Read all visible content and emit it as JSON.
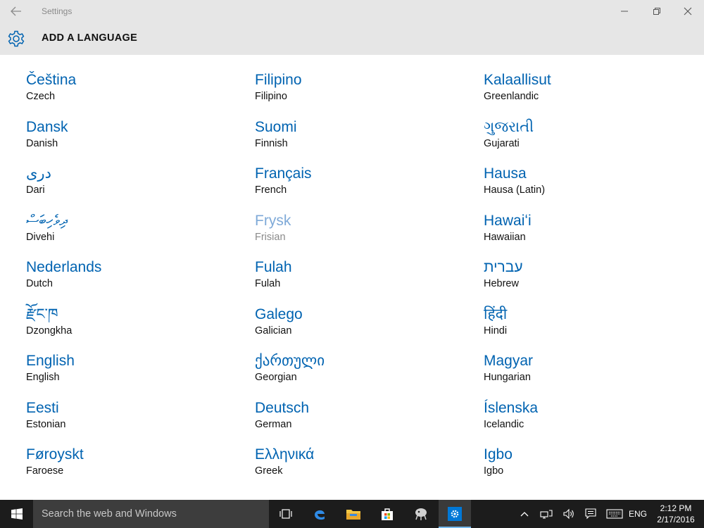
{
  "window": {
    "title": "Settings",
    "page_title": "ADD A LANGUAGE"
  },
  "columns": [
    [
      {
        "native": "Čeština",
        "english": "Czech",
        "enabled": true
      },
      {
        "native": "Dansk",
        "english": "Danish",
        "enabled": true
      },
      {
        "native": "درى",
        "english": "Dari",
        "enabled": true
      },
      {
        "native": "ދިވެހިބަސް",
        "english": "Divehi",
        "enabled": true
      },
      {
        "native": "Nederlands",
        "english": "Dutch",
        "enabled": true
      },
      {
        "native": "རྫོང་ཁ",
        "english": "Dzongkha",
        "enabled": true
      },
      {
        "native": "English",
        "english": "English",
        "enabled": true
      },
      {
        "native": "Eesti",
        "english": "Estonian",
        "enabled": true
      },
      {
        "native": "Føroyskt",
        "english": "Faroese",
        "enabled": true
      }
    ],
    [
      {
        "native": "Filipino",
        "english": "Filipino",
        "enabled": true
      },
      {
        "native": "Suomi",
        "english": "Finnish",
        "enabled": true
      },
      {
        "native": "Français",
        "english": "French",
        "enabled": true
      },
      {
        "native": "Frysk",
        "english": "Frisian",
        "enabled": false
      },
      {
        "native": "Fulah",
        "english": "Fulah",
        "enabled": true
      },
      {
        "native": "Galego",
        "english": "Galician",
        "enabled": true
      },
      {
        "native": "ქართული",
        "english": "Georgian",
        "enabled": true
      },
      {
        "native": "Deutsch",
        "english": "German",
        "enabled": true
      },
      {
        "native": "Ελληνικά",
        "english": "Greek",
        "enabled": true
      }
    ],
    [
      {
        "native": "Kalaallisut",
        "english": "Greenlandic",
        "enabled": true
      },
      {
        "native": "ગુજરાતી",
        "english": "Gujarati",
        "enabled": true
      },
      {
        "native": "Hausa",
        "english": "Hausa (Latin)",
        "enabled": true
      },
      {
        "native": "Hawaiʻi",
        "english": "Hawaiian",
        "enabled": true
      },
      {
        "native": "עברית",
        "english": "Hebrew",
        "enabled": true
      },
      {
        "native": "हिंदी",
        "english": "Hindi",
        "enabled": true
      },
      {
        "native": "Magyar",
        "english": "Hungarian",
        "enabled": true
      },
      {
        "native": "Íslenska",
        "english": "Icelandic",
        "enabled": true
      },
      {
        "native": "Igbo",
        "english": "Igbo",
        "enabled": true
      }
    ]
  ],
  "taskbar": {
    "search_placeholder": "Search the web and Windows",
    "input_language": "ENG",
    "time": "2:12 PM",
    "date": "2/17/2016"
  },
  "colors": {
    "accent": "#0063b1",
    "header_bg": "#e6e6e6",
    "taskbar_bg": "#1c1c1c",
    "disabled_text": "#7faad8"
  },
  "icons": {
    "titlebar": [
      "back-arrow-icon",
      "minimize-icon",
      "restore-icon",
      "close-icon"
    ],
    "header": "gear-icon",
    "taskbar": [
      "windows-logo-icon",
      "task-view-icon",
      "edge-icon",
      "file-explorer-icon",
      "store-icon",
      "app-icon",
      "settings-icon"
    ],
    "tray": [
      "chevron-up-icon",
      "network-icon",
      "volume-icon",
      "action-center-icon",
      "keyboard-icon"
    ]
  }
}
